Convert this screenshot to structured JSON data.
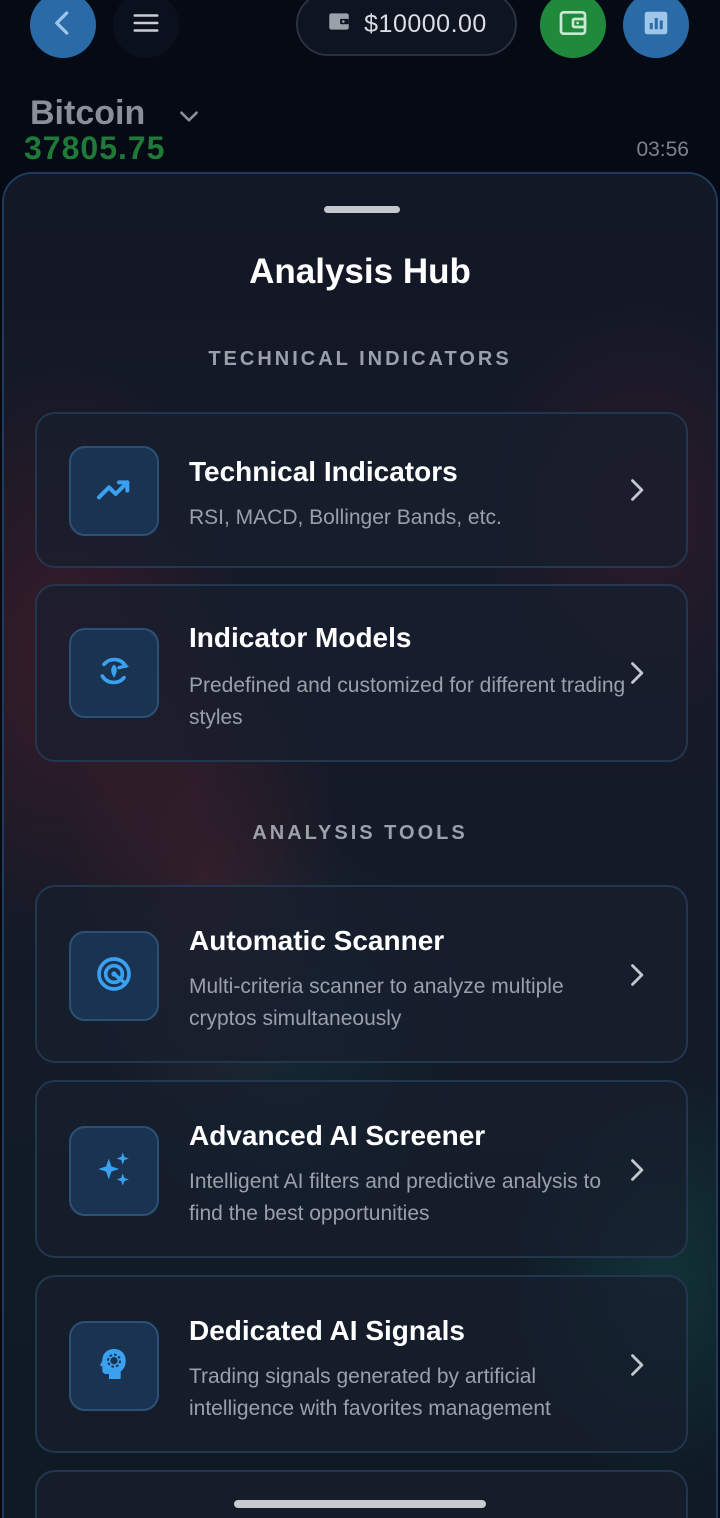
{
  "header": {
    "balance": "$10000.00",
    "coin_name": "Bitcoin",
    "coin_price": "37805.75",
    "time": "03:56"
  },
  "sheet": {
    "title": "Analysis Hub",
    "sections": [
      {
        "label": "TECHNICAL INDICATORS",
        "items": [
          {
            "title": "Technical Indicators",
            "description": "RSI, MACD, Bollinger Bands, etc.",
            "icon": "trending-up-icon"
          },
          {
            "title": "Indicator Models",
            "description": "Predefined and customized for different trading styles",
            "icon": "model-refresh-icon"
          }
        ]
      },
      {
        "label": "ANALYSIS TOOLS",
        "items": [
          {
            "title": "Automatic Scanner",
            "description": "Multi-criteria scanner to analyze multiple cryptos simultaneously",
            "icon": "radar-icon"
          },
          {
            "title": "Advanced AI Screener",
            "description": "Intelligent AI filters and predictive analysis to find the best opportunities",
            "icon": "sparkles-icon"
          },
          {
            "title": "Dedicated AI Signals",
            "description": "Trading signals generated by artificial intelligence with favorites management",
            "icon": "ai-head-icon"
          }
        ]
      }
    ]
  },
  "colors": {
    "accent_blue": "#2a6aa6",
    "wallet_green": "#1f8a3c",
    "price_green": "#1f7a3a",
    "icon_blue": "#3aa0f0"
  }
}
